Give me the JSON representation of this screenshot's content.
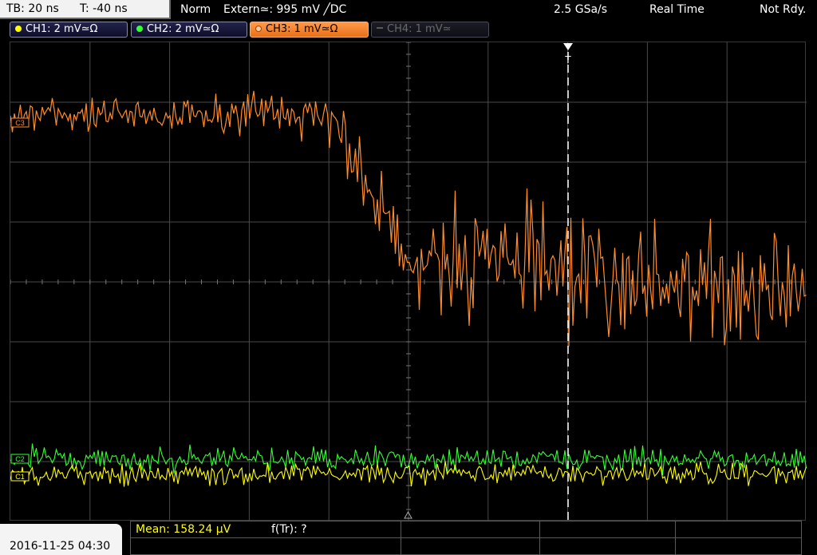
{
  "topbar": {
    "timebase": "TB: 20 ns",
    "trigger_time": "T: -40 ns",
    "acq_mode": "Norm",
    "trigger_source": "Extern≃: 995 mV ╱DC",
    "sample_rate": "2.5 GSa/s",
    "mode": "Real Time",
    "status": "Not Rdy."
  },
  "channels": [
    {
      "label": "CH1: 2 mV≃Ω",
      "color": "#ffff00",
      "state": "on"
    },
    {
      "label": "CH2: 2 mV≃Ω",
      "color": "#33ff33",
      "state": "on"
    },
    {
      "label": "CH3: 1 mV≃Ω",
      "color": "#ff8c2a",
      "state": "selected"
    },
    {
      "label": "CH4: 1 mV≃",
      "color": "#6a6a6a",
      "state": "off"
    }
  ],
  "screen": {
    "trigger_marker": "T",
    "ch3_marker": "C3",
    "ch2_marker": "C2",
    "ch1_marker": "C1"
  },
  "bottombar": {
    "datetime": "2016-11-25 04:30",
    "measure1": "Mean: 158.24 µV",
    "measure2": "f(Tr): ?"
  },
  "colors": {
    "ch1": "#ffff00",
    "ch2": "#33ff33",
    "ch3": "#ff8c2a",
    "grid": "#555555",
    "measure_text": "#ffff00"
  }
}
